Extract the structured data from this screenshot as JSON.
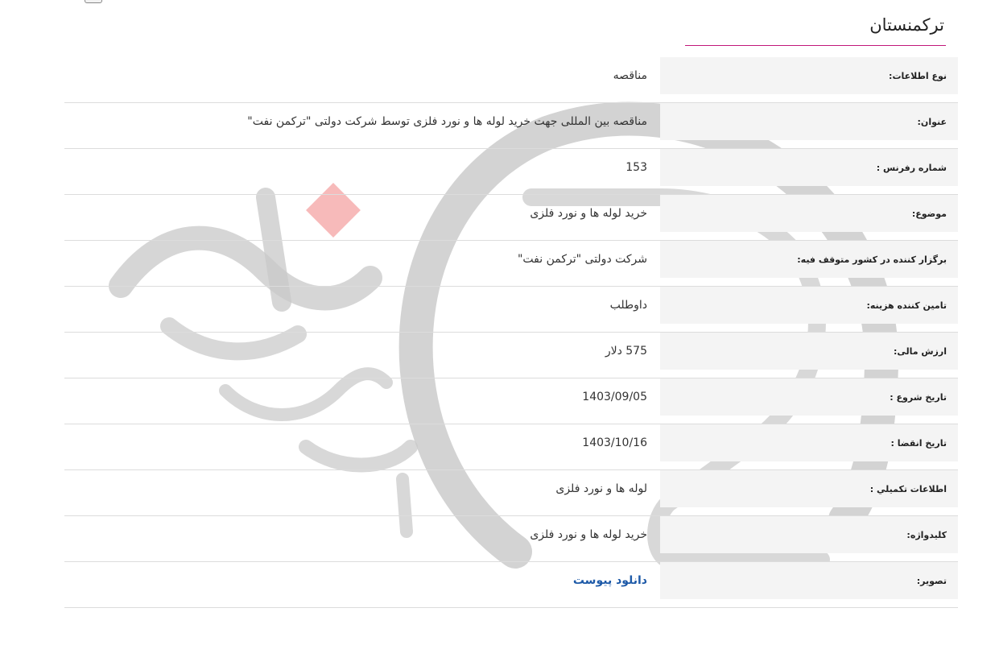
{
  "page": {
    "title": "ترکمنستان",
    "accent_color": "#c2187a",
    "link_color": "#1e5aa8"
  },
  "toolbar": {
    "print_icon": "printer-icon"
  },
  "rows": [
    {
      "label": "نوع اطلاعات:",
      "value": "مناقصه"
    },
    {
      "label": "عنوان:",
      "value": "مناقصه بین المللی جهت خرید لوله ها و نورد فلزی توسط شرکت دولتی \"ترکمن نفت\""
    },
    {
      "label": "شماره رفرنس :",
      "value": "153"
    },
    {
      "label": "موضوع:",
      "value": "خرید لوله ها و نورد فلزی"
    },
    {
      "label": "برگزار کننده در کشور متوقف فیه:",
      "value": "شرکت دولتی \"ترکمن نفت\""
    },
    {
      "label": "تامین کننده هزینه:",
      "value": "داوطلب"
    },
    {
      "label": "ارزش مالی:",
      "value": "575 دلار"
    },
    {
      "label": "تاریخ شروع :",
      "value": "1403/09/05"
    },
    {
      "label": "تاریخ انقضا :",
      "value": "1403/10/16"
    },
    {
      "label": "اطلاعات تکمیلي :",
      "value": "لوله ها و نورد فلزی"
    },
    {
      "label": "کلیدواژه:",
      "value": "خرید لوله ها و نورد فلزی"
    },
    {
      "label": "تصویر:",
      "link_text": "دانلود پیوست"
    }
  ]
}
